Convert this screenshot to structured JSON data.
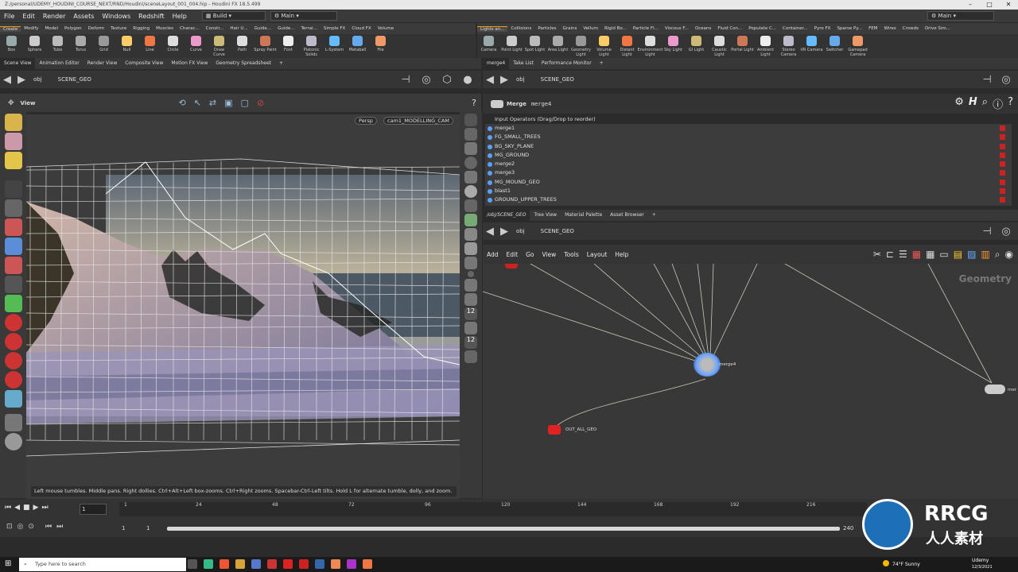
{
  "titlebar": {
    "text": "Z:/personal/UDEMY_HOUDINI_COURSE_NEXT/RND/Houdini/sceneLayout_001_004.hip - Houdini FX 18.5.499"
  },
  "menubar": {
    "items": [
      "File",
      "Edit",
      "Render",
      "Assets",
      "Windows",
      "Redshift",
      "Help"
    ],
    "build": "Build",
    "main_left": "Main",
    "main_right": "Main"
  },
  "shelf_left_tabs": [
    "Create",
    "Modify",
    "Model",
    "Polygon",
    "Deform",
    "Texture",
    "Rigging",
    "Muscles",
    "Charac...",
    "Constr...",
    "Hair U...",
    "Guide...",
    "Guide...",
    "Terrai...",
    "Simple FX",
    "Cloud FX",
    "Volume"
  ],
  "shelf_left_tools": [
    "Box",
    "Sphere",
    "Tube",
    "Torus",
    "Grid",
    "Null",
    "Line",
    "Circle",
    "Curve",
    "Draw Curve",
    "Path",
    "Spray Paint",
    "Font",
    "Platonic Solids",
    "L-System",
    "Metaball",
    "File"
  ],
  "shelf_right_tabs": [
    "Lights an...",
    "Collisions",
    "Particles",
    "Grains",
    "Vellum",
    "Rigid Bo...",
    "Particle Fl...",
    "Viscous F...",
    "Oceans",
    "Fluid Con...",
    "Populate C...",
    "Container...",
    "Pyro FX",
    "Sparse Py...",
    "FEM",
    "Wires",
    "Crowds",
    "Drive Sim..."
  ],
  "shelf_right_tools": [
    "Camera",
    "Point Light",
    "Spot Light",
    "Area Light",
    "Geometry Light",
    "Volume Light",
    "Distant Light",
    "Environment Light",
    "Sky Light",
    "GI Light",
    "Caustic Light",
    "Portal Light",
    "Ambient Light",
    "Stereo Camera",
    "VR Camera",
    "Switcher",
    "Gamepad Camera"
  ],
  "left_pane": {
    "tabs": [
      "Scene View",
      "Animation Editor",
      "Render View",
      "Composite View",
      "Motion FX View",
      "Geometry Spreadsheet"
    ],
    "path_obj": "obj",
    "path_geo": "SCENE_GEO",
    "view_label": "View",
    "persp": "Persp",
    "camera": "cam1_MODELLING_CAM",
    "hint": "Left mouse tumbles. Middle pans. Right dollies. Ctrl+Alt+Left box-zooms. Ctrl+Right zooms. Spacebar-Ctrl-Left tilts. Hold L for alternate tumble, dolly, and zoom."
  },
  "param_pane": {
    "tabs": [
      "merge4",
      "Take List",
      "Performance Monitor"
    ],
    "path_obj": "obj",
    "path_geo": "SCENE_GEO",
    "node_type": "Merge",
    "node_name": "merge4",
    "list_header": "Input Operators (Drag/Drop to reorder)",
    "inputs": [
      "merge1",
      "FG_SMALL_TREES",
      "BG_SKY_PLANE",
      "MG_GROUND",
      "merge2",
      "merge3",
      "MG_MOUND_GEO",
      "blast1",
      "GROUND_UPPER_TREES"
    ]
  },
  "network_pane": {
    "tabs": [
      "/obj/SCENE_GEO",
      "Tree View",
      "Material Palette",
      "Asset Browser"
    ],
    "path_obj": "obj",
    "path_geo": "SCENE_GEO",
    "menu": [
      "Add",
      "Edit",
      "Go",
      "View",
      "Tools",
      "Layout",
      "Help"
    ],
    "context_label": "Geometry",
    "merge_node": "merge4",
    "out_node": "OUT_ALL_GEO",
    "right_node": "mer"
  },
  "timeline": {
    "frame": "1",
    "start": "1",
    "start2": "1",
    "end": "240",
    "ticks": [
      "1",
      "24",
      "48",
      "72",
      "96",
      "120",
      "144",
      "168",
      "192",
      "216"
    ]
  },
  "taskbar": {
    "search_placeholder": "Type here to search",
    "weather": "74°F Sunny",
    "date": "12/3/2021",
    "udemy": "Udemy"
  },
  "watermarks": {
    "rrcg": "RRCG",
    "cn": "人人素材"
  }
}
